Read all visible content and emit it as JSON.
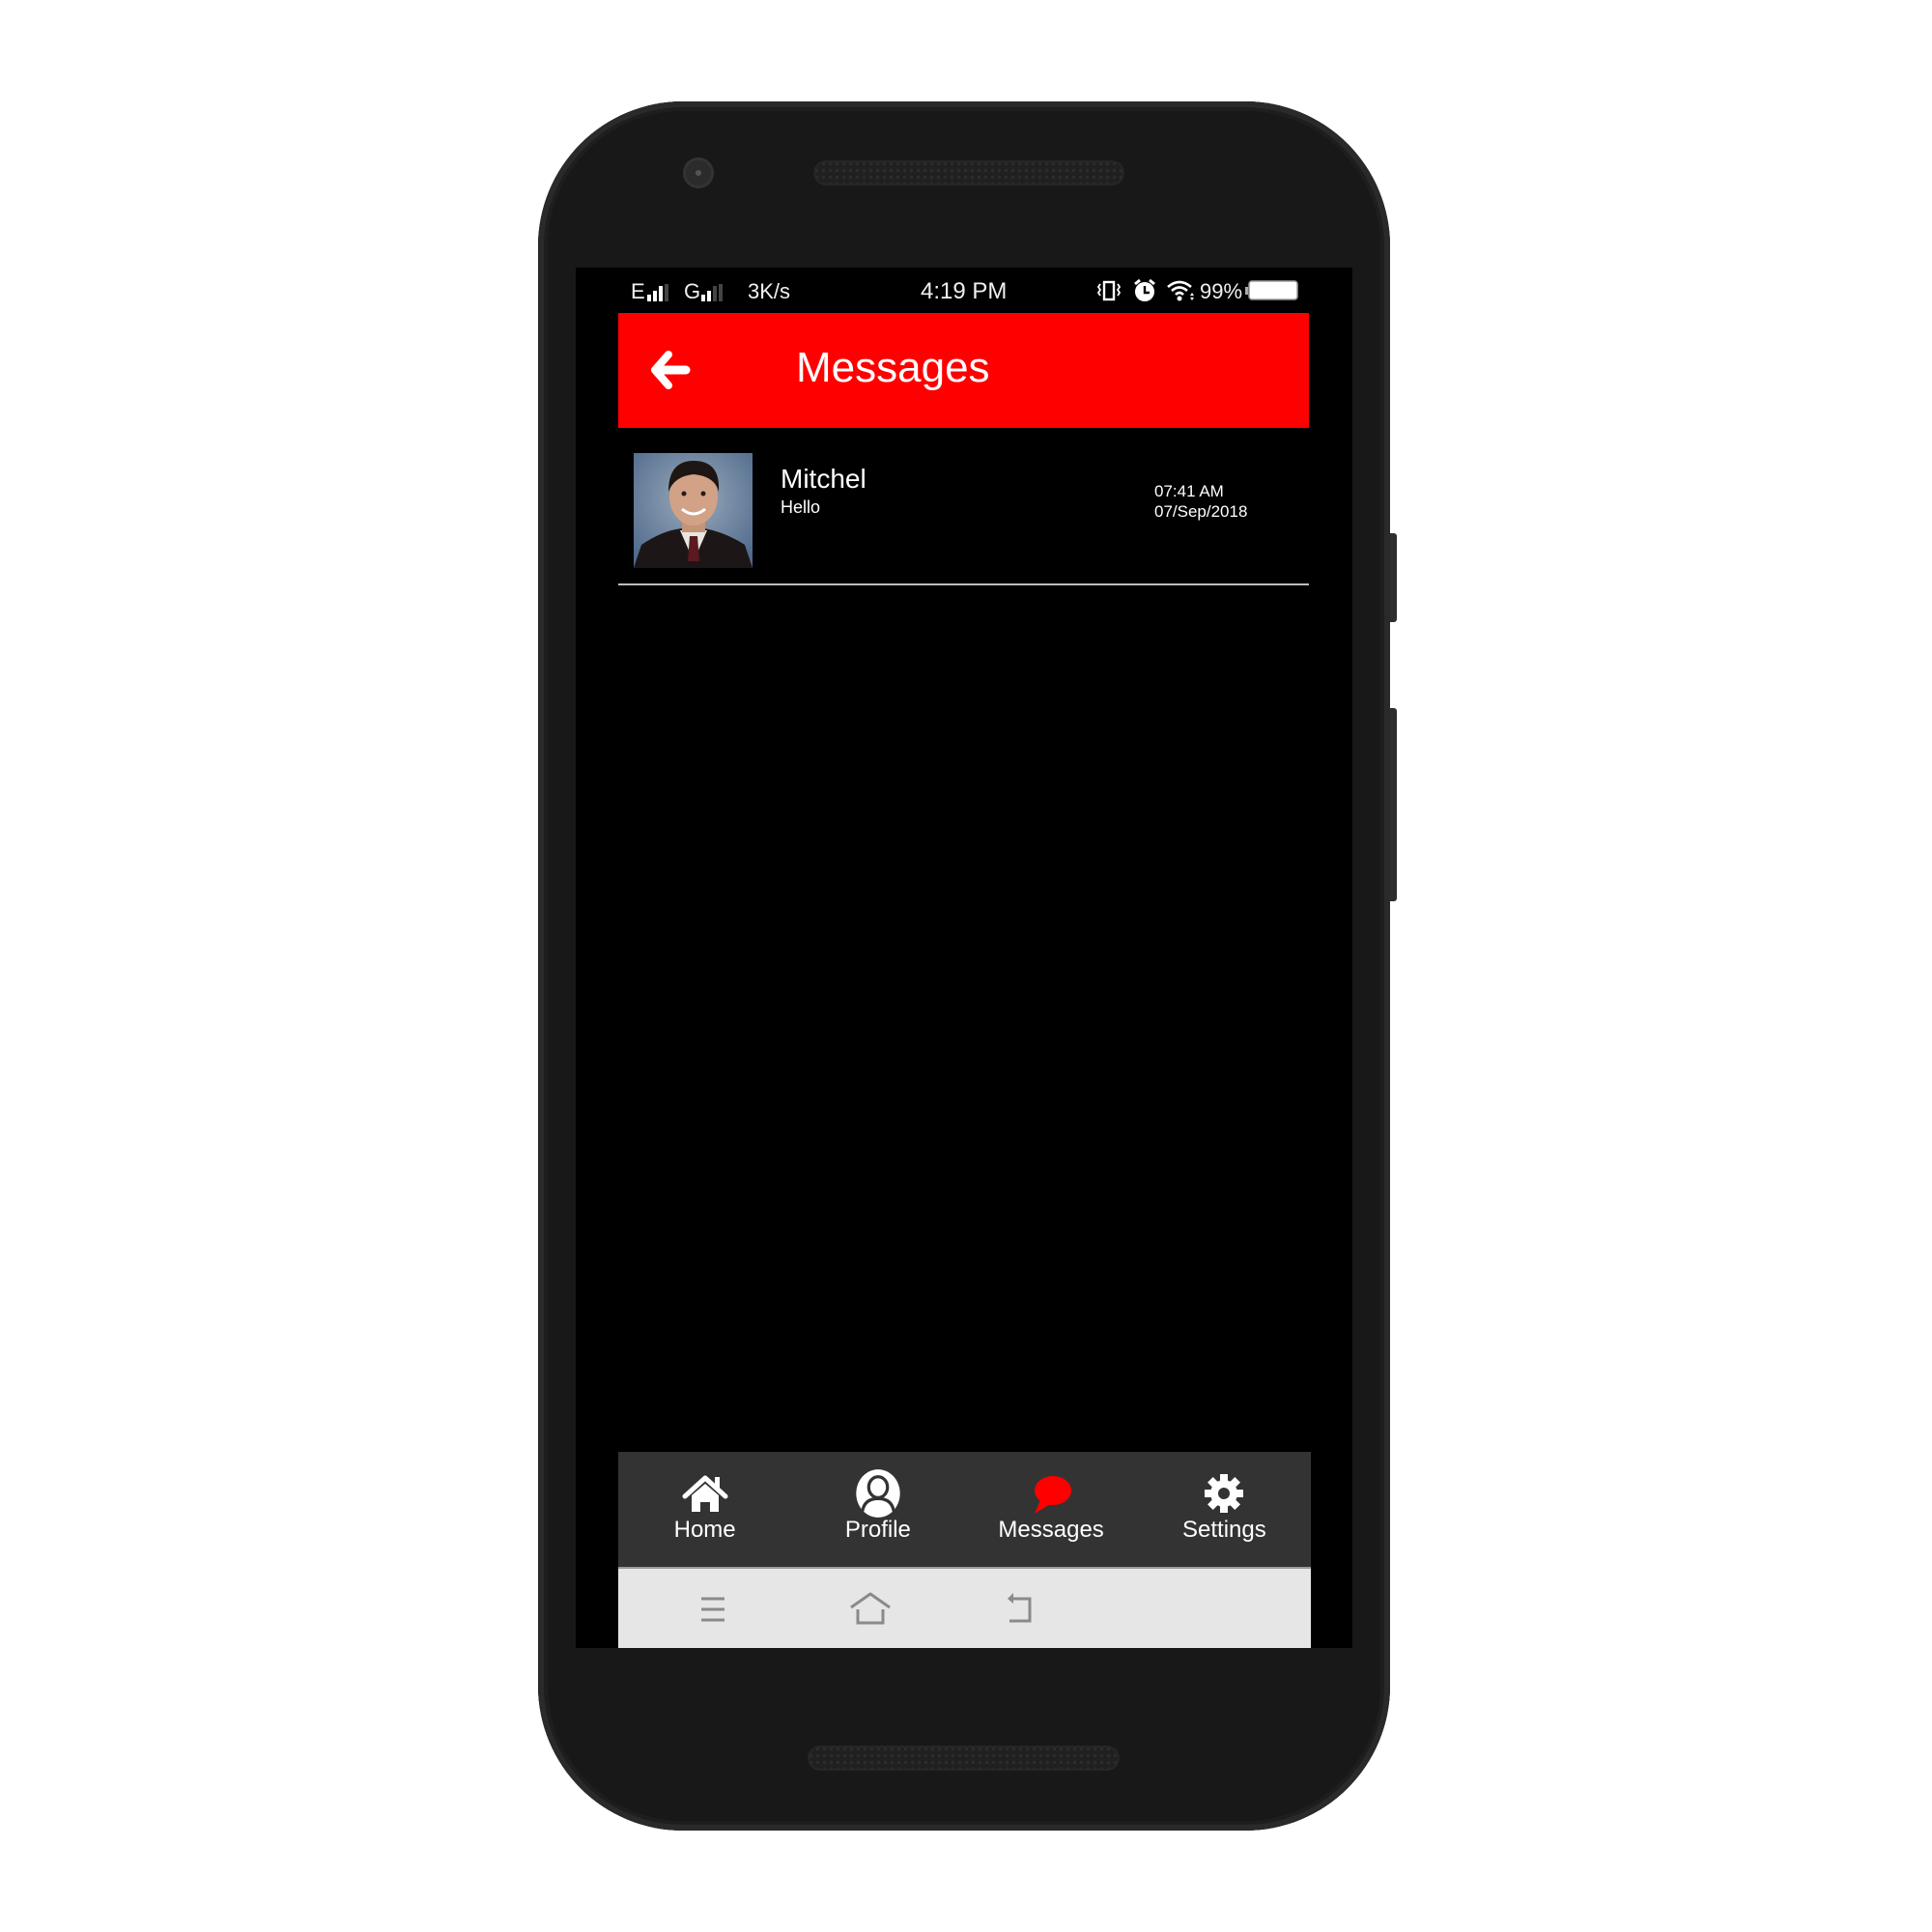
{
  "status_bar": {
    "network1": "E",
    "network2": "G",
    "speed": "3K/s",
    "time": "4:19 PM",
    "battery": "99%",
    "icons": [
      "signal-icon",
      "vibrate-icon",
      "alarm-icon",
      "wifi-icon",
      "battery-icon"
    ]
  },
  "app_bar": {
    "title": "Messages",
    "back_icon": "arrow-left-icon",
    "color": "#ff0000"
  },
  "conversations": [
    {
      "name": "Mitchel",
      "preview": "Hello",
      "time": "07:41 AM",
      "date": "07/Sep/2018",
      "avatar": "person-photo"
    }
  ],
  "bottom_nav": {
    "active": "Messages",
    "active_color": "#ff0000",
    "items": [
      {
        "label": "Home",
        "icon": "home-icon"
      },
      {
        "label": "Profile",
        "icon": "profile-icon"
      },
      {
        "label": "Messages",
        "icon": "chat-bubble-icon"
      },
      {
        "label": "Settings",
        "icon": "gear-icon"
      }
    ]
  },
  "system_nav": {
    "icons": [
      "menu-icon",
      "home-icon",
      "back-icon"
    ]
  }
}
